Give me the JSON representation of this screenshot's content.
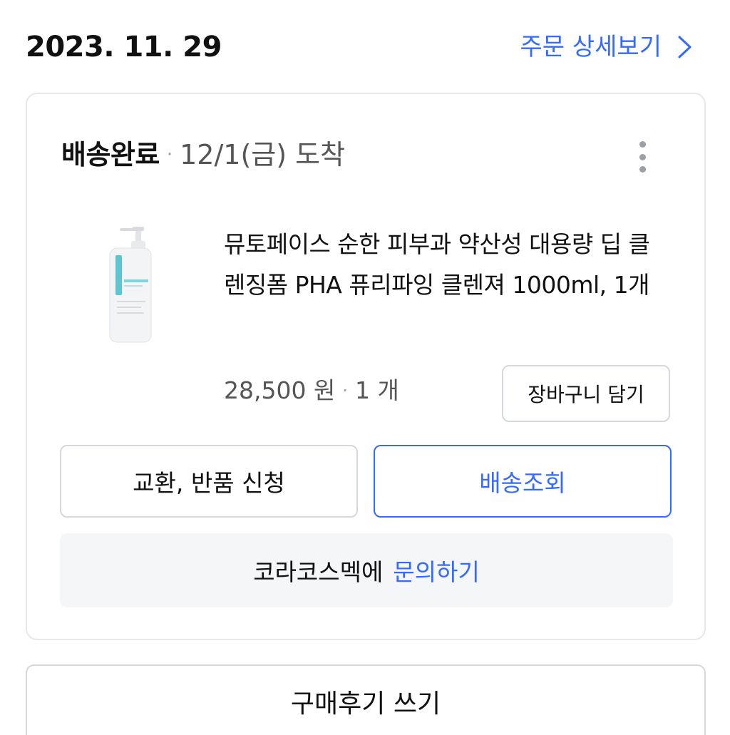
{
  "order": {
    "date": "2023. 11. 29",
    "detail_link": "주문 상세보기"
  },
  "shipment": {
    "status": "배송완료",
    "separator": "·",
    "arrival": "12/1(금) 도착"
  },
  "product": {
    "name": "뮤토페이스 순한 피부과 약산성 대용량 딥 클렌징폼 PHA 퓨리파잉 클렌져 1000ml, 1개",
    "price": "28,500 원",
    "separator": "·",
    "quantity": "1 개",
    "image_icon": "product-bottle-image"
  },
  "buttons": {
    "add_to_cart": "장바구니 담기",
    "exchange_return": "교환, 반품 신청",
    "track_delivery": "배송조회",
    "write_review": "구매후기 쓰기"
  },
  "inquiry": {
    "seller_text": "코라코스멕에",
    "link_text": "문의하기"
  },
  "colors": {
    "accent": "#346aff",
    "border": "#d4d7dc",
    "muted_text": "#555555",
    "inquiry_bg": "#f5f6f8"
  },
  "icons": {
    "chevron": "chevron-right-icon",
    "menu": "more-vertical-icon"
  }
}
